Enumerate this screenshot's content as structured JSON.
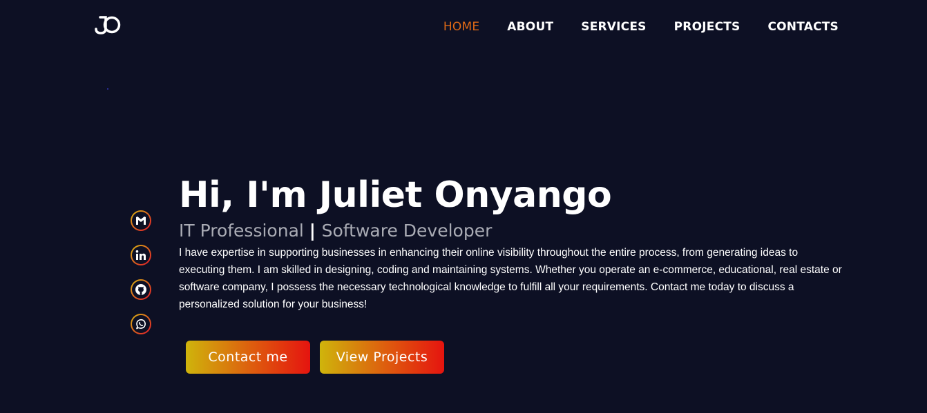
{
  "brand": {
    "logo_text": "JO",
    "icon": "jo-monogram-logo"
  },
  "nav": {
    "items": [
      {
        "label": "HOME",
        "active": true
      },
      {
        "label": "ABOUT",
        "active": false
      },
      {
        "label": "SERVICES",
        "active": false
      },
      {
        "label": "PROJECTS",
        "active": false
      },
      {
        "label": "CONTACTS",
        "active": false
      }
    ]
  },
  "socials": [
    {
      "icon": "gmail-icon"
    },
    {
      "icon": "linkedin-icon"
    },
    {
      "icon": "github-icon"
    },
    {
      "icon": "whatsapp-icon"
    }
  ],
  "hero": {
    "heading": "Hi, I'm Juliet Onyango",
    "role_1": "IT Professional",
    "role_separator": "|",
    "role_2": "Software Developer",
    "description": "I have expertise in supporting businesses in enhancing their online visibility throughout the entire process, from generating ideas to executing them. I am skilled in designing, coding and maintaining systems. Whether you operate an e-commerce, educational, real estate or software company, I possess the necessary technological knowledge to fulfill all your requirements. Contact me today to discuss a personalized solution for your business!"
  },
  "buttons": {
    "contact_label": "Contact me",
    "projects_label": "View Projects"
  },
  "colors": {
    "background": "#0d1024",
    "accent_active_nav": "#e06a16",
    "gradient_start": "#cfb40c",
    "gradient_end": "#e5140f",
    "muted_text": "#a9abb4"
  }
}
